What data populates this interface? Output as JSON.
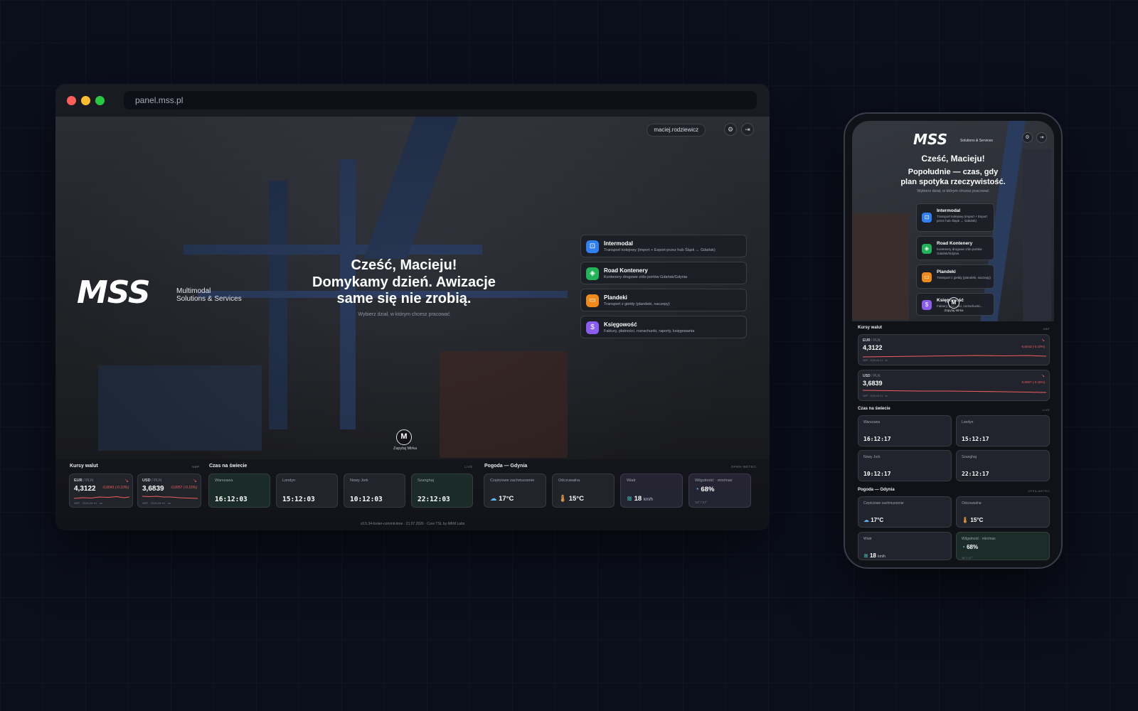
{
  "browser": {
    "url": "panel.mss.pl"
  },
  "header": {
    "user": "maciej.rodziewicz",
    "account_icon": "user-gear-icon",
    "logout_icon": "logout-icon"
  },
  "brand": {
    "logo": "MSS",
    "tagline_1": "Multimodal",
    "tagline_2": "Solutions & Services"
  },
  "hero": {
    "greeting": "Cześć, Macieju!",
    "line_1": "Domykamy dzień. Awizacje",
    "line_2": "same się nie zrobią.",
    "hint": "Wybierz dział, w którym chcesz pracować"
  },
  "departments": [
    {
      "name": "Intermodal",
      "desc": "Transport kolejowy (import + Export przez hub Śląsk ↔ Gdańsk)",
      "color": "#2f7ff0",
      "icon": "train-icon"
    },
    {
      "name": "Road Kontenery",
      "desc": "Kontenery drogowe z/do portów Gdańsk/Gdynia",
      "color": "#22b35a",
      "icon": "box-icon"
    },
    {
      "name": "Plandeki",
      "desc": "Transport z giełdy (plandeki, naczepy)",
      "color": "#f08a1c",
      "icon": "truck-icon"
    },
    {
      "name": "Księgowość",
      "desc": "Faktury, płatności, rozrachunki, raporty, księgowania",
      "color": "#8a5cf0",
      "icon": "money-icon"
    }
  ],
  "assistant": {
    "label": "Zapytaj Mirka",
    "letter": "M"
  },
  "fx": {
    "title": "Kursy walut",
    "tag": "NBP",
    "rates": [
      {
        "pair": "EUR",
        "quote": "/ PLN",
        "rate": "4,3122",
        "change": "-0,0043 (-0.10%)",
        "date": "NBP · 2026-06-31 · on"
      },
      {
        "pair": "USD",
        "quote": "/ PLN",
        "rate": "3,6839",
        "change": "-0,0057 (-0.15%)",
        "date": "NBP · 2026-06-31 · on"
      }
    ],
    "trend_color": "#f0605a"
  },
  "clocks": {
    "title": "Czas na świecie",
    "tag": "LIVE",
    "desktop": [
      {
        "city": "Warszawa",
        "time": "16:12:03"
      },
      {
        "city": "Londyn",
        "time": "15:12:03"
      },
      {
        "city": "Nowy Jork",
        "time": "10:12:03"
      },
      {
        "city": "Szanghaj",
        "time": "22:12:03"
      }
    ],
    "mobile": [
      {
        "city": "Warszawa",
        "time": "16:12:17"
      },
      {
        "city": "Londyn",
        "time": "15:12:17"
      },
      {
        "city": "Nowy Jork",
        "time": "10:12:17"
      },
      {
        "city": "Szanghaj",
        "time": "22:12:17"
      }
    ]
  },
  "weather": {
    "title": "Pogoda — Gdynia",
    "tag": "OPEN-METEO",
    "items": [
      {
        "label": "Częściowe zachmurzenie",
        "value": "17°C",
        "unit": "",
        "icon": "cloud-sun-icon"
      },
      {
        "label": "Odczuwalna",
        "value": "15°C",
        "unit": "",
        "icon": "thermometer-icon"
      },
      {
        "label": "Wiatr",
        "value": "18",
        "unit": "km/h",
        "icon": "wind-icon"
      },
      {
        "label": "Wilgotność · min/max",
        "value": "68%",
        "unit": "",
        "sub": "14° / 17°",
        "icon": "humidity-icon"
      }
    ]
  },
  "footer": {
    "text": "v3.5.34-footer-commit-time · 21.07.2026 · Core TSL by MKM Labs"
  },
  "mobile": {
    "greeting": "Cześć, Macieju!",
    "line_1": "Popołudnie — czas, gdy",
    "line_2": "plan spotyka rzeczywistość.",
    "hint": "Wybierz dział, w którym chcesz pracować",
    "departments": [
      {
        "name": "Intermodal",
        "desc": "Transport kolejowy (import + Export przez hub Śląsk ↔ Gdańsk)"
      },
      {
        "name": "Road Kontenery",
        "desc": "Kontenery drogowe z/do portów Gdańsk/Gdynia"
      },
      {
        "name": "Plandeki",
        "desc": "Transport z giełdy (plandeki, naczepy)"
      },
      {
        "name": "Księgowość",
        "desc": "Faktury, płatności, rozrachunki..."
      }
    ]
  }
}
